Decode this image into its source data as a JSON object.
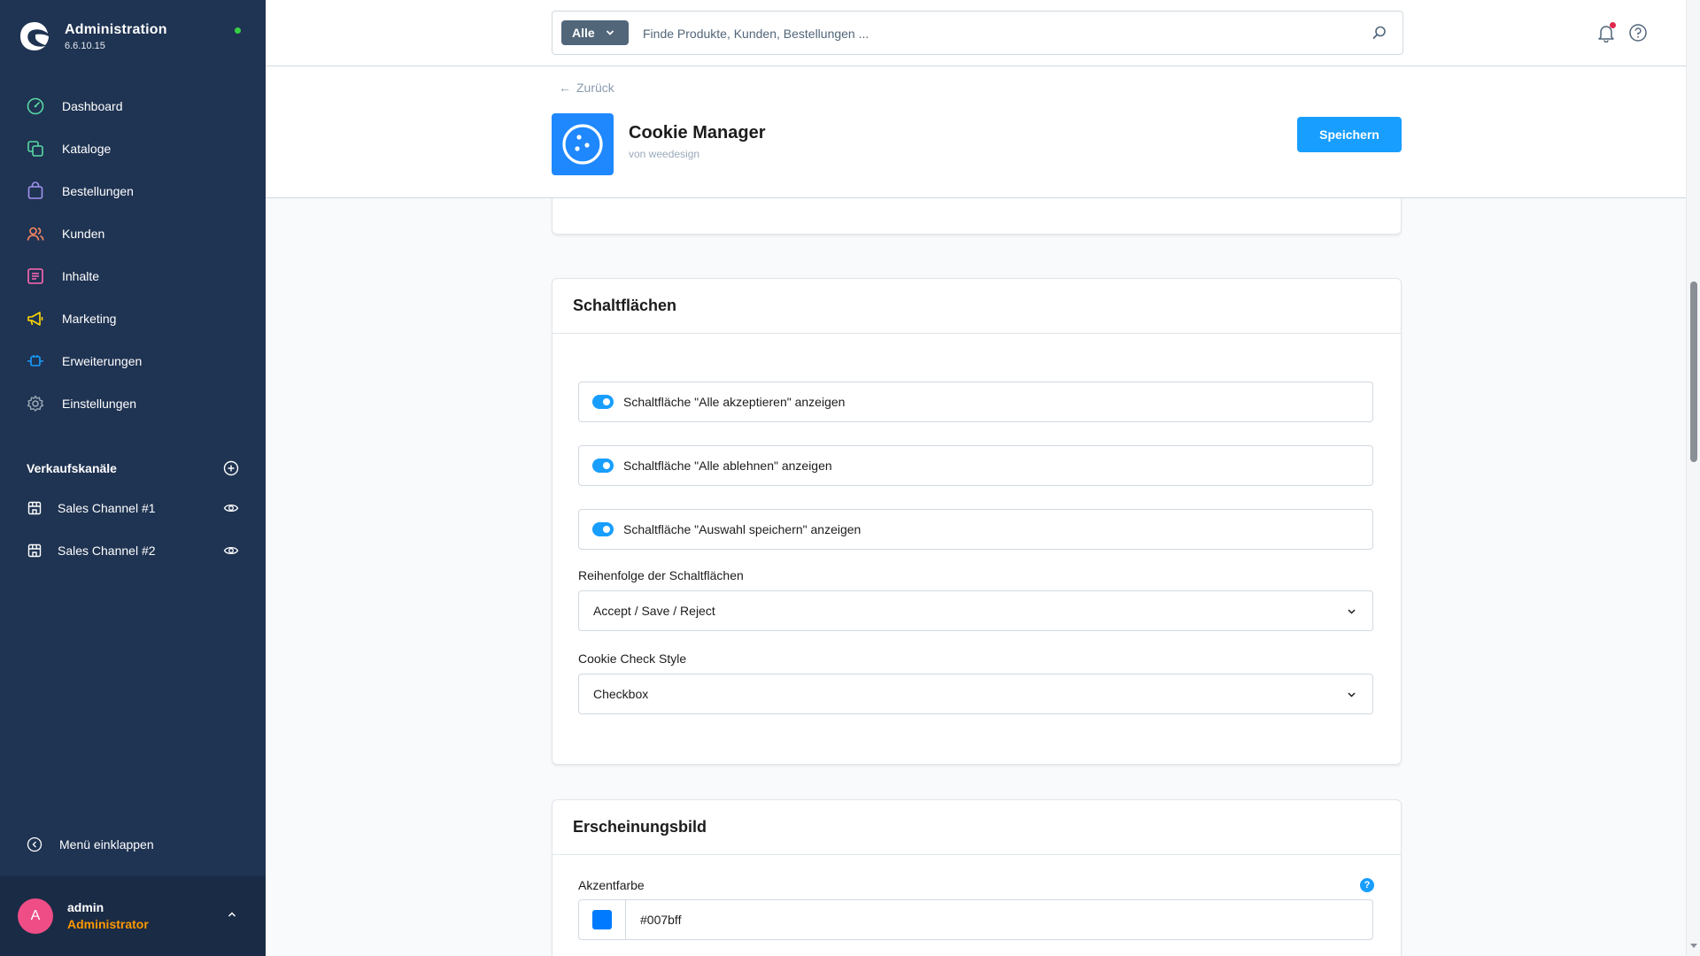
{
  "brand": {
    "title": "Administration",
    "version": "6.6.10.15"
  },
  "nav": [
    {
      "label": "Dashboard",
      "icon": "dashboard-icon",
      "color": "#57d9a3"
    },
    {
      "label": "Kataloge",
      "icon": "catalog-icon",
      "color": "#57d9a3"
    },
    {
      "label": "Bestellungen",
      "icon": "orders-icon",
      "color": "#a092f0"
    },
    {
      "label": "Kunden",
      "icon": "customers-icon",
      "color": "#f88962"
    },
    {
      "label": "Inhalte",
      "icon": "content-icon",
      "color": "#ff68b4"
    },
    {
      "label": "Marketing",
      "icon": "marketing-icon",
      "color": "#ffd700"
    },
    {
      "label": "Erweiterungen",
      "icon": "extensions-icon",
      "color": "#189eff"
    },
    {
      "label": "Einstellungen",
      "icon": "settings-icon",
      "color": "#9aa8b5"
    }
  ],
  "sales_channels": {
    "title": "Verkaufskanäle",
    "items": [
      {
        "label": "Sales Channel #1"
      },
      {
        "label": "Sales Channel #2"
      }
    ]
  },
  "collapse_label": "Menü einklappen",
  "user": {
    "initial": "A",
    "name": "admin",
    "role": "Administrator"
  },
  "search": {
    "type_label": "Alle",
    "placeholder": "Finde Produkte, Kunden, Bestellungen ..."
  },
  "header": {
    "back_label": "Zurück",
    "extension_name": "Cookie Manager",
    "extension_author": "von weedesign",
    "save_label": "Speichern"
  },
  "buttons_card": {
    "title": "Schaltflächen",
    "switches": [
      {
        "label": "Schaltfläche \"Alle akzeptieren\" anzeigen",
        "checked": true
      },
      {
        "label": "Schaltfläche \"Alle ablehnen\" anzeigen",
        "checked": true
      },
      {
        "label": "Schaltfläche \"Auswahl speichern\" anzeigen",
        "checked": true
      }
    ],
    "order_label": "Reihenfolge der Schaltflächen",
    "order_value": "Accept / Save / Reject",
    "check_style_label": "Cookie Check Style",
    "check_style_value": "Checkbox"
  },
  "appearance_card": {
    "title": "Erscheinungsbild",
    "accent_label": "Akzentfarbe",
    "accent_value": "#007bff",
    "help_glyph": "?"
  },
  "colors": {
    "sidebar": "#1f3352",
    "primary": "#189eff",
    "accent_swatch": "#007bff",
    "role": "#ff9800",
    "avatar": "#ef4d86"
  }
}
